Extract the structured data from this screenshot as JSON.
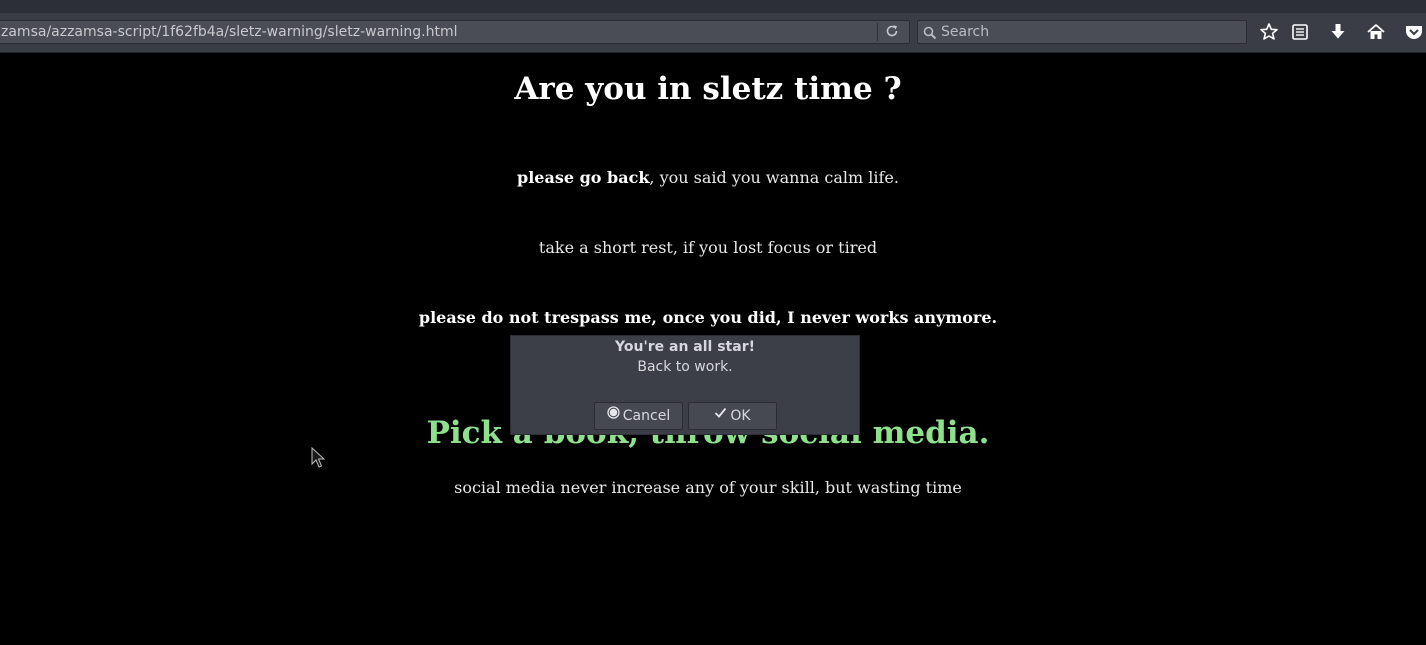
{
  "browser": {
    "url": "zamsa/azzamsa-script/1f62fb4a/sletz-warning/sletz-warning.html",
    "search_placeholder": "Search",
    "toolbar_icons": [
      "reload-icon",
      "search-icon",
      "bookmark-star-icon",
      "reading-list-icon",
      "download-icon",
      "home-icon",
      "pocket-icon"
    ]
  },
  "page": {
    "title": "Are you in sletz time ?",
    "p1_bold": "please go back",
    "p1_rest": ", you said you wanna calm life.",
    "p2": "take a short rest, if you lost focus or tired",
    "p3": "please do not trespass me, once you did, I never works anymore.",
    "heading2": "Pick a book, throw social media.",
    "p4": "social media never increase any of your skill, but wasting time",
    "heading2_color": "#8fe08c",
    "background": "#000000"
  },
  "dialog": {
    "title": "You're an all star!",
    "message": "Back to work.",
    "cancel_label": "Cancel",
    "ok_label": "OK"
  }
}
